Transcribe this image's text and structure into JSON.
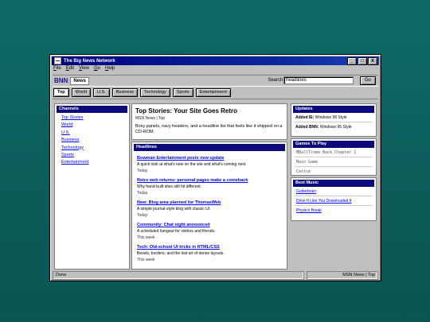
{
  "window": {
    "title": "The Big News Network",
    "buttons": [
      "_",
      "□",
      "X"
    ]
  },
  "menu": [
    "File",
    "Edit",
    "View",
    "Go",
    "Help"
  ],
  "brand": {
    "name": "BNN",
    "badge": "News"
  },
  "search": {
    "label": "Search:",
    "value": "headlines",
    "button": "Go"
  },
  "tabs": [
    {
      "label": "Top",
      "active": true
    },
    {
      "label": "World"
    },
    {
      "label": "U.S."
    },
    {
      "label": "Business"
    },
    {
      "label": "Technology"
    },
    {
      "label": "Sports"
    },
    {
      "label": "Entertainment"
    }
  ],
  "channels": {
    "title": "Channels",
    "items": [
      "Top Stories",
      "World",
      "U.S.",
      "Business",
      "Technology",
      "Sports",
      "Entertainment"
    ]
  },
  "top_story": {
    "title": "Top Stories: Your Site Goes Retro",
    "meta": "MSN News | Top",
    "description": "Boxy panels, navy headers, and a headline list that feels like it shipped on a CD-ROM."
  },
  "headlines": {
    "title": "Headlines",
    "items": [
      {
        "title": "Bowman Entertainment posts new update",
        "summary": "A quick look at what's new on the site and what's coming next.",
        "when": "Today"
      },
      {
        "title": "Retro web returns: personal pages make a comeback",
        "summary": "Why hand-built sites still hit different.",
        "when": "Today"
      },
      {
        "title": "New: Blog area planned for ThomasWeb",
        "summary": "A simple journal-style blog with classic UI.",
        "when": "Today"
      },
      {
        "title": "Community: Chat night announced",
        "summary": "A scheduled hangout for visitors and friends.",
        "when": "This week"
      },
      {
        "title": "Tech: Old-school UI tricks in HTML/CSS",
        "summary": "Bevels, borders, and the lost art of dense layouts.",
        "when": "This week"
      }
    ]
  },
  "updates": {
    "title": "Updates",
    "items": [
      {
        "label": "Added IE:",
        "value": "Windows 98 Style"
      },
      {
        "label": "Added BNN:",
        "value": "Windows 95 Style"
      }
    ]
  },
  "games": {
    "title": "Games To Play",
    "items": [
      "MBallTrome Back Chapter 1",
      "Main Game",
      "Catice"
    ]
  },
  "music": {
    "title": "Best Music",
    "items": [
      "Gutterbrain",
      "Drive It Like You Downloaded It",
      "Physics Break"
    ]
  },
  "status": {
    "left": "Done.",
    "right": "MSN News | Top"
  },
  "colors": {
    "desktop": "#0f6a66",
    "titlebar": "#000080",
    "panel_head": "#0a0a7a",
    "link": "#0000ff"
  }
}
